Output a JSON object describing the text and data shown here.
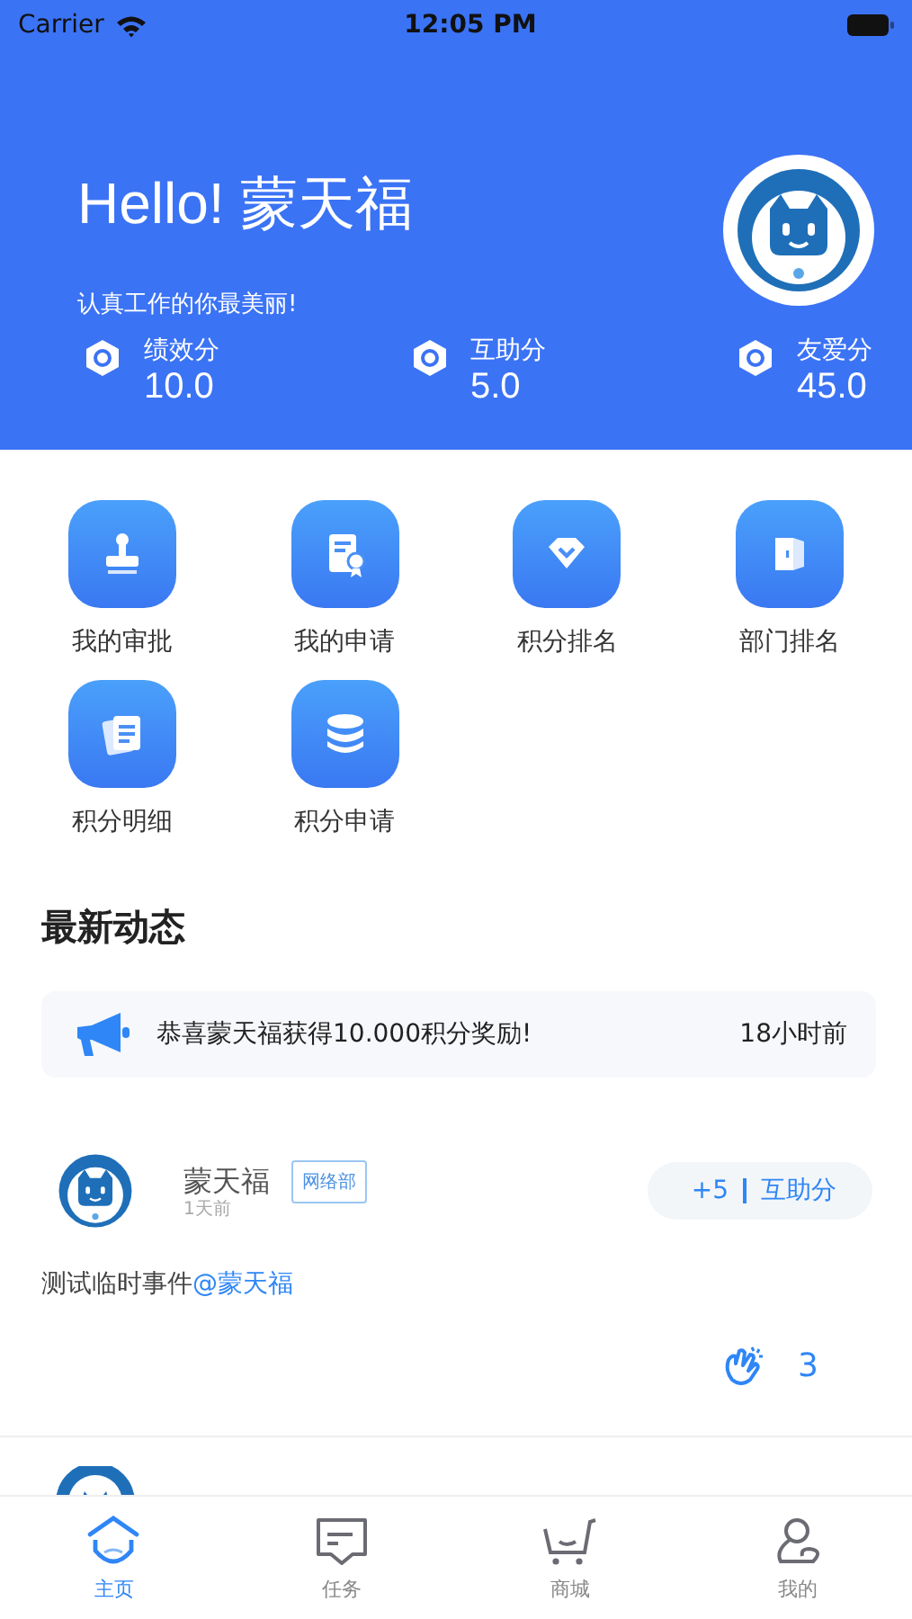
{
  "status_bar": {
    "carrier": "Carrier",
    "time": "12:05 PM"
  },
  "header": {
    "greeting": "Hello! 蒙天福",
    "motto": "认真工作的你最美丽!",
    "stats": [
      {
        "label": "绩效分",
        "value": "10.0"
      },
      {
        "label": "互助分",
        "value": "5.0"
      },
      {
        "label": "友爱分",
        "value": "45.0"
      }
    ]
  },
  "shortcuts": [
    {
      "kind": "stamp",
      "label": "我的审批"
    },
    {
      "kind": "certificate",
      "label": "我的申请"
    },
    {
      "kind": "diamond",
      "label": "积分排名"
    },
    {
      "kind": "door",
      "label": "部门排名"
    },
    {
      "kind": "documents",
      "label": "积分明细"
    },
    {
      "kind": "coins",
      "label": "积分申请"
    }
  ],
  "feed_title": "最新动态",
  "notice": {
    "text": "恭喜蒙天福获得10.000积分奖励!",
    "time": "18小时前"
  },
  "posts": [
    {
      "name": "蒙天福",
      "department": "网络部",
      "time": "1天前",
      "points": "+5",
      "category": "互助分",
      "content": "测试临时事件",
      "mention": "@蒙天福",
      "claps": "3"
    }
  ],
  "tabs": [
    {
      "kind": "home",
      "label": "主页",
      "selected": true
    },
    {
      "kind": "task",
      "label": "任务",
      "selected": false
    },
    {
      "kind": "shop",
      "label": "商城",
      "selected": false
    },
    {
      "kind": "me",
      "label": "我的",
      "selected": false
    }
  ]
}
